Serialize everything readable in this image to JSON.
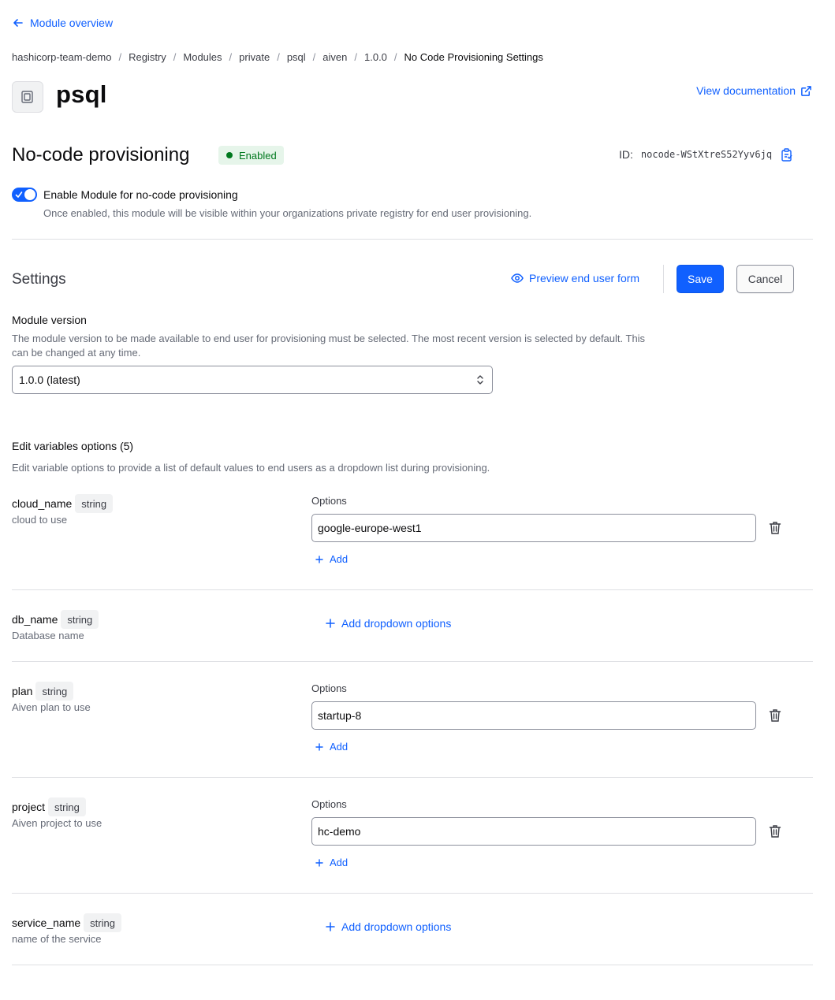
{
  "nav": {
    "back_label": "Module overview"
  },
  "breadcrumb": [
    "hashicorp-team-demo",
    "Registry",
    "Modules",
    "private",
    "psql",
    "aiven",
    "1.0.0",
    "No Code Provisioning Settings"
  ],
  "breadcrumb_separator": "/",
  "module": {
    "title": "psql",
    "view_doc_label": "View documentation",
    "icon": "module-icon"
  },
  "nocode": {
    "title": "No-code provisioning",
    "status": "Enabled",
    "id_label": "ID:",
    "id_value": "nocode-WStXtreS52Yyv6jq",
    "toggle_label": "Enable Module for no-code provisioning",
    "toggle_help": "Once enabled, this module will be visible within your organizations private registry for end user provisioning.",
    "toggle_on": true
  },
  "settings": {
    "title": "Settings",
    "preview_label": "Preview end user form",
    "save_label": "Save",
    "cancel_label": "Cancel",
    "module_version_label": "Module version",
    "module_version_help": "The module version to be made available to end user for provisioning must be selected. The most recent version is selected by default. This can be changed at any time.",
    "module_version_value": "1.0.0 (latest)"
  },
  "variables": {
    "title": "Edit variables options (5)",
    "help": "Edit variable options to provide a list of default values to end users as a dropdown list during provisioning.",
    "options_label": "Options",
    "add_label": "Add",
    "add_dropdown_label": "Add dropdown options",
    "items": [
      {
        "name": "cloud_name",
        "type": "string",
        "desc": "cloud to use",
        "options": [
          "google-europe-west1"
        ]
      },
      {
        "name": "db_name",
        "type": "string",
        "desc": "Database name",
        "options": []
      },
      {
        "name": "plan",
        "type": "string",
        "desc": "Aiven plan to use",
        "options": [
          "startup-8"
        ]
      },
      {
        "name": "project",
        "type": "string",
        "desc": "Aiven project to use",
        "options": [
          "hc-demo"
        ]
      },
      {
        "name": "service_name",
        "type": "string",
        "desc": "name of the service",
        "options": []
      }
    ]
  },
  "colors": {
    "accent": "#1060ff",
    "success": "#00781e",
    "success_bg": "#e6f5ea",
    "muted": "#656a76",
    "border": "#dedfe3"
  }
}
